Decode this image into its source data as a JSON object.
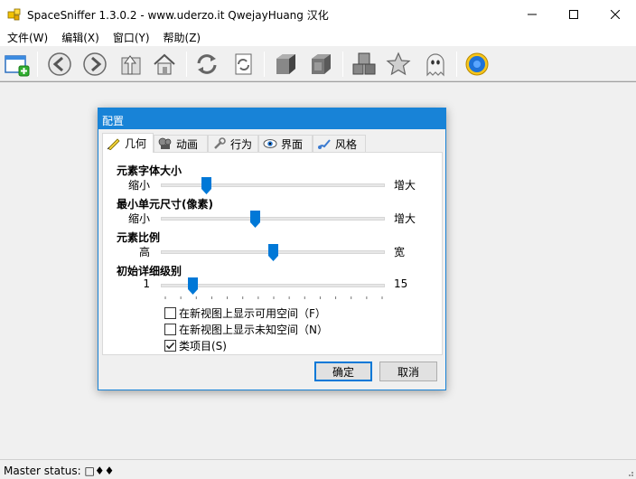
{
  "window": {
    "title": "SpaceSniffer 1.3.0.2 - www.uderzo.it  QwejayHuang 汉化"
  },
  "menu": [
    "文件(W)",
    "编辑(X)",
    "窗口(Y)",
    "帮助(Z)"
  ],
  "toolbar": {
    "buttons": [
      "new-view-icon",
      "back-icon",
      "forward-icon",
      "up-icon",
      "home-icon",
      "refresh-icon",
      "refresh-selected-icon",
      "zoom-in-icon",
      "zoom-out-icon",
      "boxes-icon",
      "star-icon",
      "ghost-icon",
      "settings-icon"
    ]
  },
  "status": {
    "text": "Master status: □♦♦"
  },
  "dialog": {
    "title": "配置",
    "tabs": [
      "几何",
      "动画",
      "行为",
      "界面",
      "风格"
    ],
    "active_tab": "几何",
    "sliders": [
      {
        "label": "元素字体大小",
        "min_label": "缩小",
        "max_label": "增大",
        "position": 0.2
      },
      {
        "label": "最小单元尺寸(像素)",
        "min_label": "缩小",
        "max_label": "增大",
        "position": 0.42
      },
      {
        "label": "元素比例",
        "min_label": "高",
        "max_label": "宽",
        "position": 0.5
      },
      {
        "label": "初始详细级别",
        "min_label": "1",
        "max_label": "15",
        "position": 0.143
      }
    ],
    "checkboxes": [
      {
        "label": "在新视图上显示可用空间（F）",
        "checked": false
      },
      {
        "label": "在新视图上显示未知空间（N）",
        "checked": false
      },
      {
        "label": "类项目(S)",
        "checked": true
      }
    ],
    "ok": "确定",
    "cancel": "取消"
  },
  "colors": {
    "accent": "#1883d7",
    "thumb": "#0078d7"
  }
}
